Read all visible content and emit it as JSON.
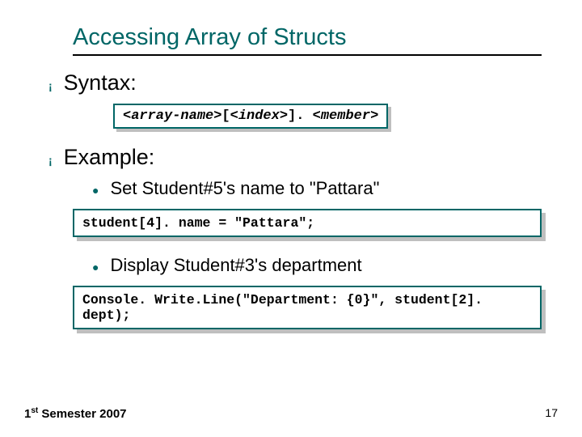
{
  "title": "Accessing Array of Structs",
  "sections": {
    "syntax": {
      "heading": "Syntax:",
      "code_parts": {
        "p1": "<array-name>",
        "p2": "[",
        "p3": "<index>",
        "p4": "]. ",
        "p5": "<member>"
      }
    },
    "example": {
      "heading": "Example:",
      "items": [
        {
          "text": "Set Student#5's name to \"Pattara\"",
          "code": "student[4]. name = \"Pattara\";"
        },
        {
          "text": "Display Student#3's department",
          "code": "Console. Write.Line(\"Department: {0}\", student[2]. dept);"
        }
      ]
    }
  },
  "footer": {
    "first": "1",
    "suffix": "st",
    "rest": " Semester 2007"
  },
  "page_number": "17"
}
